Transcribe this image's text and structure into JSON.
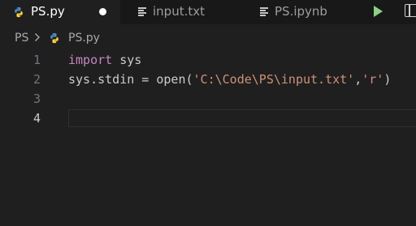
{
  "tabs": [
    {
      "label": "PS.py",
      "icon": "python-icon",
      "active": true,
      "dirty": true
    },
    {
      "label": "input.txt",
      "icon": "text-lines-icon",
      "active": false
    },
    {
      "label": "PS.ipynb",
      "icon": "text-lines-icon",
      "active": false
    }
  ],
  "actions": {
    "run": "run-icon",
    "split": "split-editor-icon"
  },
  "breadcrumb": {
    "folder": "PS",
    "separator": ">",
    "file": "PS.py"
  },
  "editor": {
    "lines": [
      {
        "number": "1",
        "tokens": {
          "kw": "import",
          "sp": " ",
          "mod": "sys"
        }
      },
      {
        "number": "2",
        "tokens": {
          "obj": "sys",
          "dot": ".",
          "attr": "stdin",
          "eq": " = ",
          "fn": "open",
          "lp": "(",
          "s1": "'C:\\Code\\PS\\input.txt'",
          "comma": ",",
          "s2": "'r'",
          "rp": ")"
        }
      },
      {
        "number": "3"
      },
      {
        "number": "4",
        "current": true
      }
    ]
  },
  "colors": {
    "background": "#1f1f1f",
    "tabbar": "#181818",
    "keyword": "#c586c0",
    "string": "#ce9178",
    "function": "#dcdcaa",
    "run": "#89d185"
  }
}
